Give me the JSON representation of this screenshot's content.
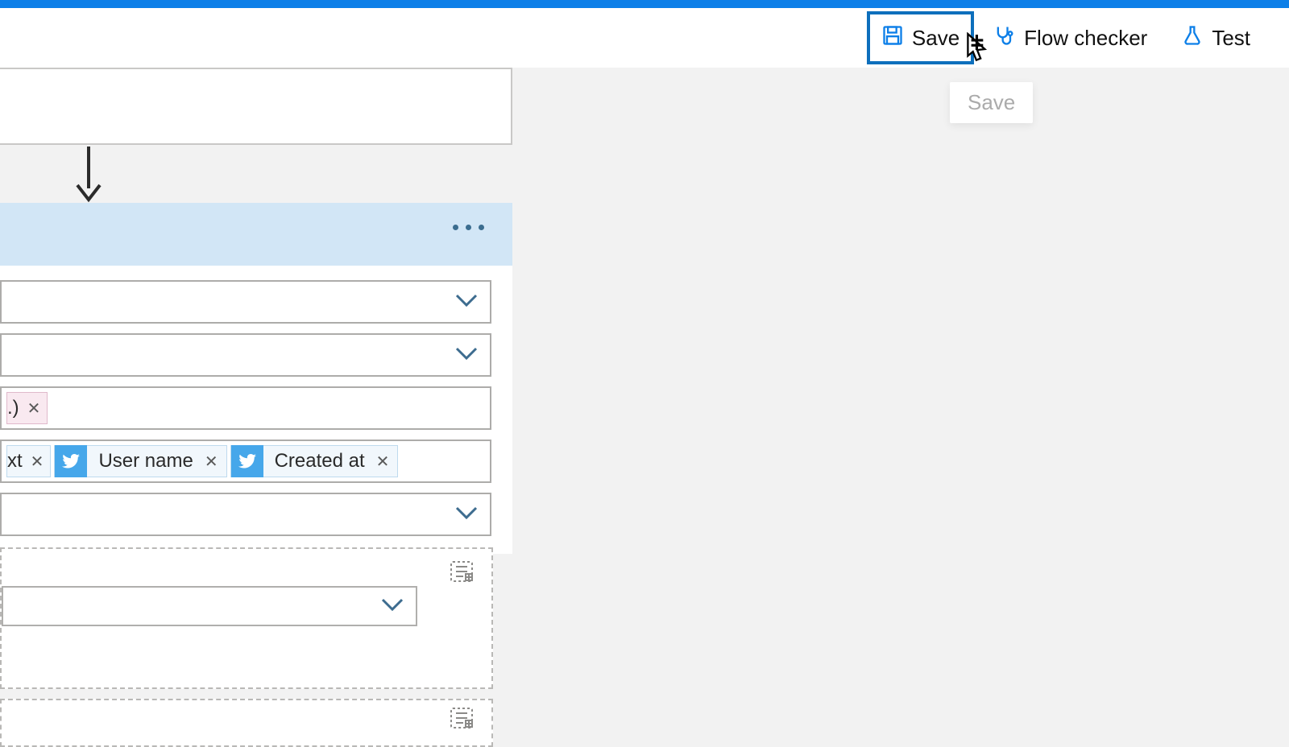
{
  "toolbar": {
    "save_label": "Save",
    "flow_checker_label": "Flow checker",
    "test_label": "Test"
  },
  "tooltip": {
    "save": "Save"
  },
  "tokens": {
    "cut_pink_suffix": ".)",
    "cut_text_suffix": "xt",
    "user_name": "User name",
    "created_at": "Created at"
  }
}
